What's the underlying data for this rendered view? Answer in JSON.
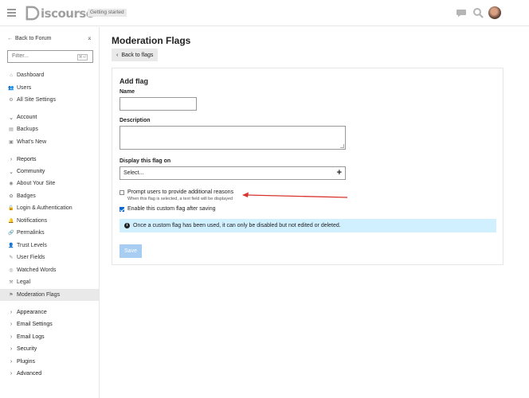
{
  "header": {
    "logo_text": "iscourse",
    "badge": "Getting started",
    "icons": [
      "chat-icon",
      "search-icon",
      "avatar"
    ]
  },
  "sidebar": {
    "back_label": "Back to Forum",
    "filter_placeholder": "Filter...",
    "filter_shortcut": "⌘+/",
    "items": [
      {
        "label": "Dashboard",
        "icon": "home-icon"
      },
      {
        "label": "Users",
        "icon": "users-icon"
      },
      {
        "label": "All Site Settings",
        "icon": "gear-icon"
      }
    ],
    "account": {
      "label": "Account",
      "items": [
        {
          "label": "Backups",
          "icon": "archive-icon"
        },
        {
          "label": "What's New",
          "icon": "gift-icon"
        }
      ]
    },
    "reports_label": "Reports",
    "community": {
      "label": "Community",
      "items": [
        {
          "label": "About Your Site",
          "icon": "globe-icon"
        },
        {
          "label": "Badges",
          "icon": "badge-icon"
        },
        {
          "label": "Login & Authentication",
          "icon": "unlock-icon"
        },
        {
          "label": "Notifications",
          "icon": "bell-icon"
        },
        {
          "label": "Permalinks",
          "icon": "link-icon"
        },
        {
          "label": "Trust Levels",
          "icon": "user-shield-icon"
        },
        {
          "label": "User Fields",
          "icon": "user-edit-icon"
        },
        {
          "label": "Watched Words",
          "icon": "eye-icon"
        },
        {
          "label": "Legal",
          "icon": "gavel-icon"
        },
        {
          "label": "Moderation Flags",
          "icon": "flag-icon"
        }
      ]
    },
    "sections": [
      {
        "label": "Appearance"
      },
      {
        "label": "Email Settings"
      },
      {
        "label": "Email Logs"
      },
      {
        "label": "Security"
      },
      {
        "label": "Plugins"
      },
      {
        "label": "Advanced"
      }
    ]
  },
  "main": {
    "title": "Moderation Flags",
    "back_button": "Back to flags",
    "form": {
      "title": "Add flag",
      "name_label": "Name",
      "name_value": "",
      "description_label": "Description",
      "description_value": "",
      "display_on_label": "Display this flag on",
      "display_on_value": "Select...",
      "prompt_checkbox": {
        "label": "Prompt users to provide additional reasons",
        "hint": "When this flag is selected, a text field will be displayed",
        "checked": false
      },
      "enable_checkbox": {
        "label": "Enable this custom flag after saving",
        "checked": true
      },
      "alert_text": "Once a custom flag has been used, it can only be disabled but not edited or deleted.",
      "save_label": "Save"
    }
  },
  "colors": {
    "accent": "#0a66d1",
    "alert_bg": "#d1f0ff",
    "save_disabled": "#a8cdf2",
    "annotation_arrow": "#d9342b"
  }
}
